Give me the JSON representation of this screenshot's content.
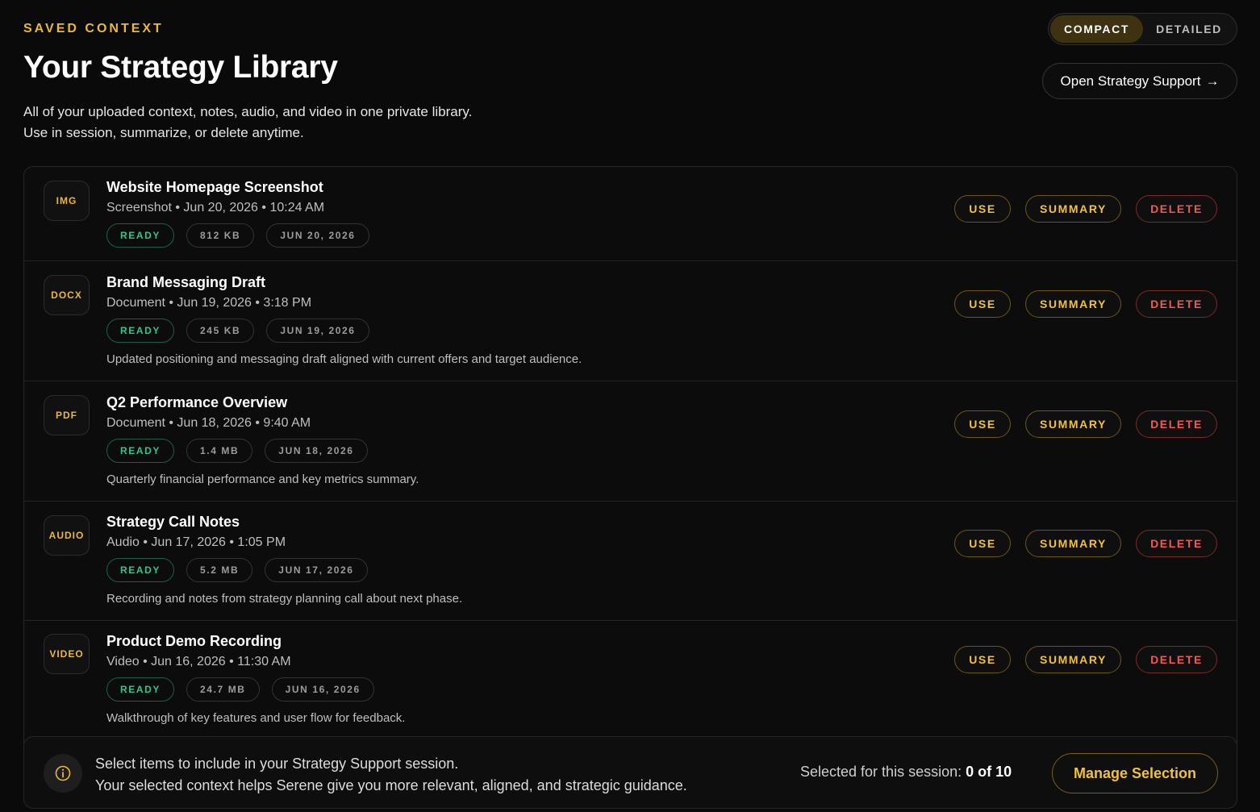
{
  "header": {
    "eyebrow": "SAVED CONTEXT",
    "title": "Your Strategy Library",
    "subtitle_line1": "All of your uploaded context, notes, audio, and video in one private library.",
    "subtitle_line2": "Use in session, summarize, or delete anytime."
  },
  "view_toggle": {
    "compact": "COMPACT",
    "detailed": "DETAILED",
    "selected": "COMPACT"
  },
  "support_link": {
    "label": "Open Strategy Support",
    "arrow": "→"
  },
  "item_actions": {
    "use": "USE",
    "summary": "SUMMARY",
    "delete": "DELETE"
  },
  "items": [
    {
      "type": "IMG",
      "title": "Website Homepage Screenshot",
      "meta": "Screenshot • Jun 20, 2026 • 10:24 AM",
      "status": "READY",
      "size": "812 KB",
      "date": "JUN 20, 2026",
      "description": ""
    },
    {
      "type": "DOCX",
      "title": "Brand Messaging Draft",
      "meta": "Document • Jun 19, 2026 • 3:18 PM",
      "status": "READY",
      "size": "245 KB",
      "date": "JUN 19, 2026",
      "description": "Updated positioning and messaging draft aligned with current offers and target audience."
    },
    {
      "type": "PDF",
      "title": "Q2 Performance Overview",
      "meta": "Document • Jun 18, 2026 • 9:40 AM",
      "status": "READY",
      "size": "1.4 MB",
      "date": "JUN 18, 2026",
      "description": "Quarterly financial performance and key metrics summary."
    },
    {
      "type": "AUDIO",
      "title": "Strategy Call Notes",
      "meta": "Audio • Jun 17, 2026 • 1:05 PM",
      "status": "READY",
      "size": "5.2 MB",
      "date": "JUN 17, 2026",
      "description": "Recording and notes from strategy planning call about next phase."
    },
    {
      "type": "VIDEO",
      "title": "Product Demo Recording",
      "meta": "Video • Jun 16, 2026 • 11:30 AM",
      "status": "READY",
      "size": "24.7 MB",
      "date": "JUN 16, 2026",
      "description": "Walkthrough of key features and user flow for feedback."
    }
  ],
  "footer": {
    "info_line1": "Select items to include in your Strategy Support session.",
    "info_line2": "Your selected context helps Serene give you more relevant, aligned, and strategic guidance.",
    "selection_label": "Selected for this session:",
    "selection_value": "0 of 10",
    "manage_button": "Manage Selection"
  },
  "colors": {
    "accent": "#e9b83a",
    "ready": "#34c48b",
    "danger": "#ee5a52",
    "background": "#0a0a0a"
  }
}
